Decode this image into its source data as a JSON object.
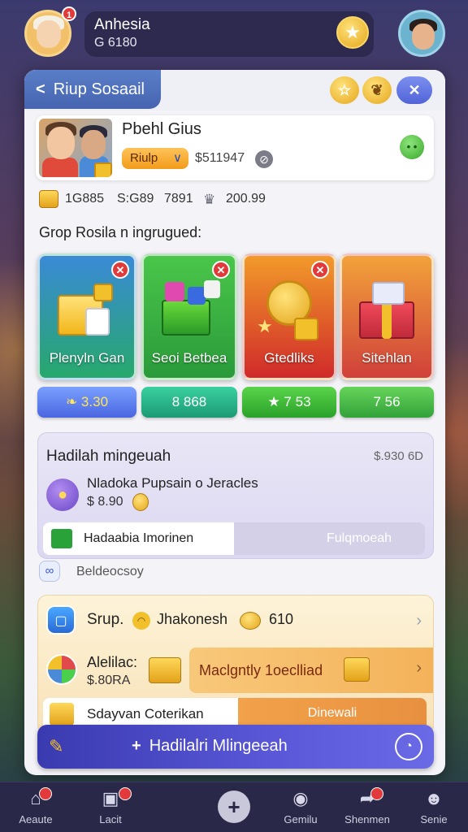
{
  "header": {
    "avatar_badge": "1",
    "username": "Anhesia",
    "coins": "G 6180",
    "star_icon": "star-icon"
  },
  "panel": {
    "back_label": "Riup Sosaail",
    "header_icons": [
      "star-icon",
      "heart-icon",
      "close-icon"
    ],
    "profile": {
      "name": "Pbehl Gius",
      "rank_label": "Riulp",
      "amount": "$511947"
    },
    "stats": [
      "1G885",
      "S:G89",
      "7891",
      "200.99"
    ],
    "section_title": "Grop Rosila n ingrugued:",
    "tiles": [
      {
        "label": "Plenyln Gan",
        "price": "❧ 3.30"
      },
      {
        "label": "Seoi Betbea",
        "price": "8 868"
      },
      {
        "label": "Gtedliks",
        "price": "★ 7 53"
      },
      {
        "label": "Sitehlan",
        "price": "7 56"
      }
    ],
    "reward": {
      "title": "Hadilah mingeuah",
      "value": "$.930 6D",
      "item_name": "Nladoka Pupsain o Jeracles",
      "item_amount": "$ 8.90",
      "progress_left": "Hadaabia Imorinen",
      "progress_right": "Fulqmoeah",
      "progress_fraction": 0.5
    },
    "badge_label": "Beldeocsoy",
    "offers": {
      "row1_a": "Srup.",
      "row1_b": "Jhakonesh",
      "row1_c": "610",
      "row2_title": "Alelilac:",
      "row2_amount": "$.80RA",
      "row2_bar": "Maclgntly 1oeclliad",
      "row3_left": "Sdayvan Coterikan",
      "row3_right": "Dinewali"
    },
    "cta_label": "Hadilalri Mlingeeah"
  },
  "nav": [
    {
      "label": "Aeaute",
      "icon": "home-icon"
    },
    {
      "label": "Lacit",
      "icon": "bag-icon"
    },
    {
      "label": "",
      "icon": "plus-icon"
    },
    {
      "label": "Gemilu",
      "icon": "film-icon"
    },
    {
      "label": "Shenmen",
      "icon": "share-icon"
    },
    {
      "label": "Senie",
      "icon": "user-icon"
    }
  ],
  "colors": {
    "accent_blue": "#4664b0",
    "gold": "#e4a61c",
    "badge_red": "#e23a3a"
  }
}
